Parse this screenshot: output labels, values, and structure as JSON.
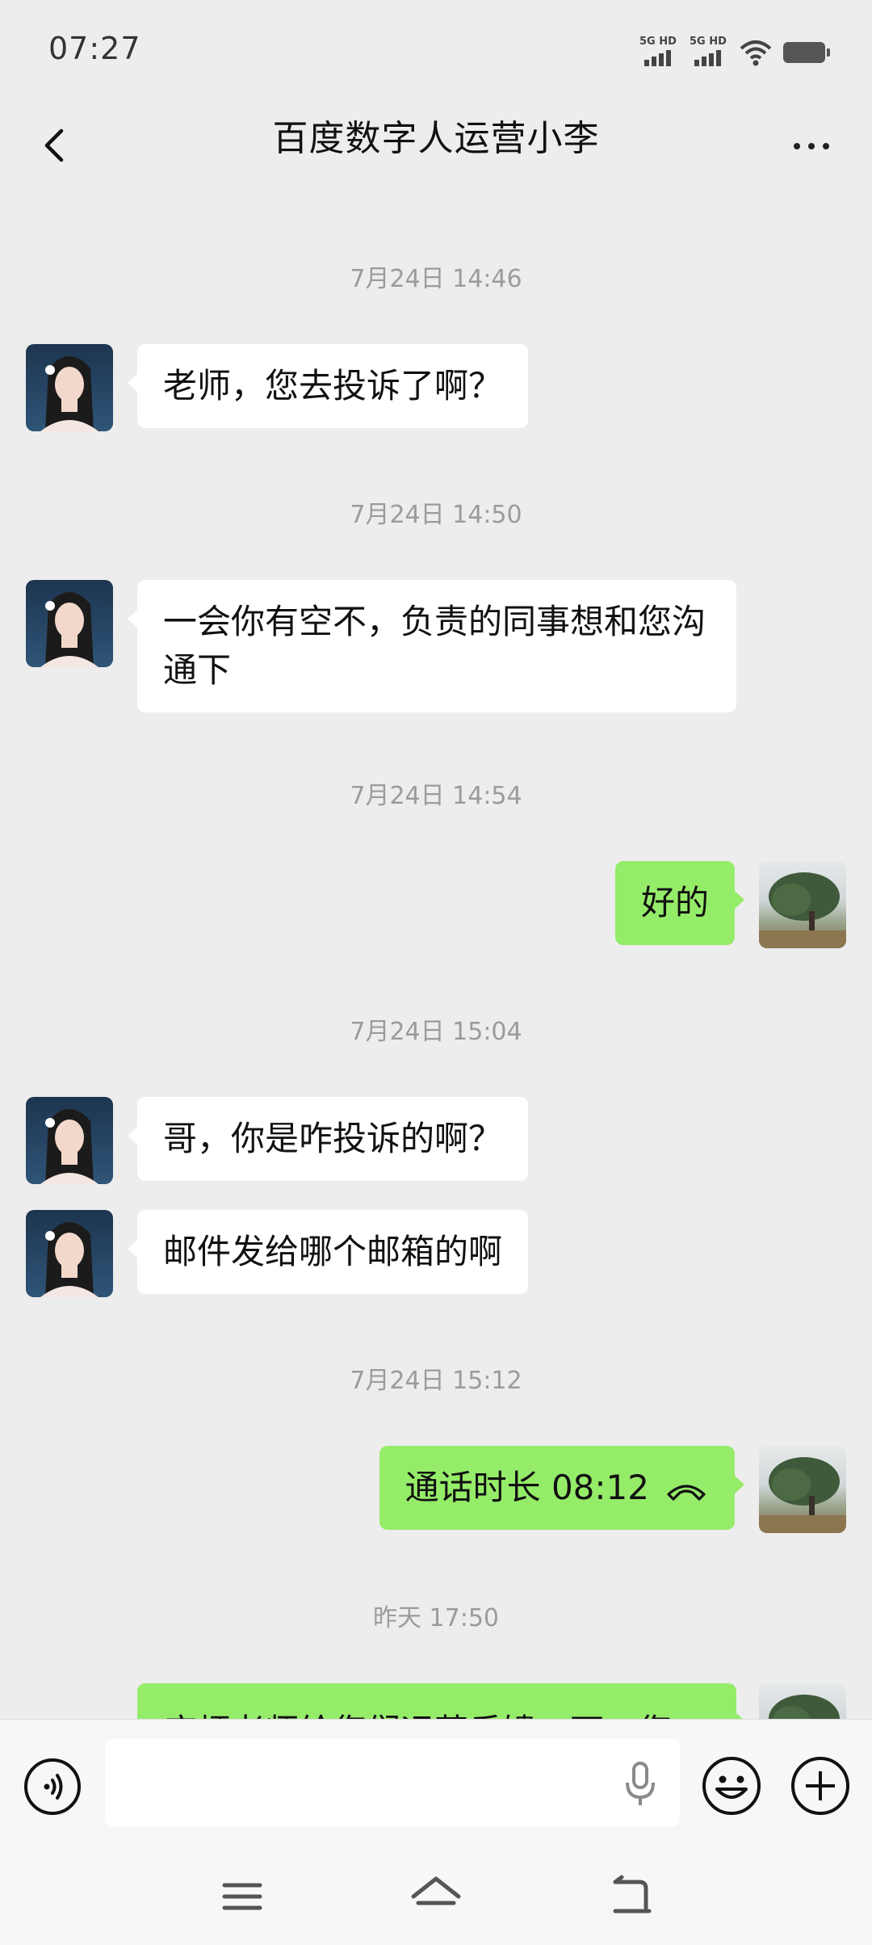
{
  "status": {
    "time": "07:27",
    "signal1_label": "5G HD",
    "signal2_label": "5G HD"
  },
  "header": {
    "title": "百度数字人运营小李"
  },
  "messages": [
    {
      "type": "time",
      "text": "7月24日 14:46"
    },
    {
      "type": "received",
      "text": "老师，您去投诉了啊？"
    },
    {
      "type": "time",
      "text": "7月24日 14:50"
    },
    {
      "type": "received",
      "text": "一会你有空不，负责的同事想和您沟通下"
    },
    {
      "type": "time",
      "text": "7月24日 14:54"
    },
    {
      "type": "sent",
      "text": "好的"
    },
    {
      "type": "time",
      "text": "7月24日 15:04"
    },
    {
      "type": "received",
      "text": "哥，你是咋投诉的啊？"
    },
    {
      "type": "received",
      "text": "邮件发给哪个邮箱的啊"
    },
    {
      "type": "time",
      "text": "7月24日 15:12"
    },
    {
      "type": "sent_call",
      "text": "通话时长 08:12"
    },
    {
      "type": "time",
      "text": "昨天 17:50"
    },
    {
      "type": "sent",
      "text": "麻烦老师给您们运营反馈一下，您"
    }
  ],
  "input": {
    "value": "",
    "placeholder": ""
  },
  "icons": {
    "back": "chevron-left-icon",
    "more": "more-dots-icon",
    "voice": "voice-icon",
    "mic": "microphone-icon",
    "emoji": "emoji-icon",
    "plus": "plus-icon",
    "call": "phone-hangup-icon",
    "menu": "menu-icon",
    "home": "home-icon",
    "return": "back-icon"
  },
  "colors": {
    "sent_bubble": "#95ec69",
    "received_bubble": "#ffffff",
    "background": "#ededed"
  }
}
